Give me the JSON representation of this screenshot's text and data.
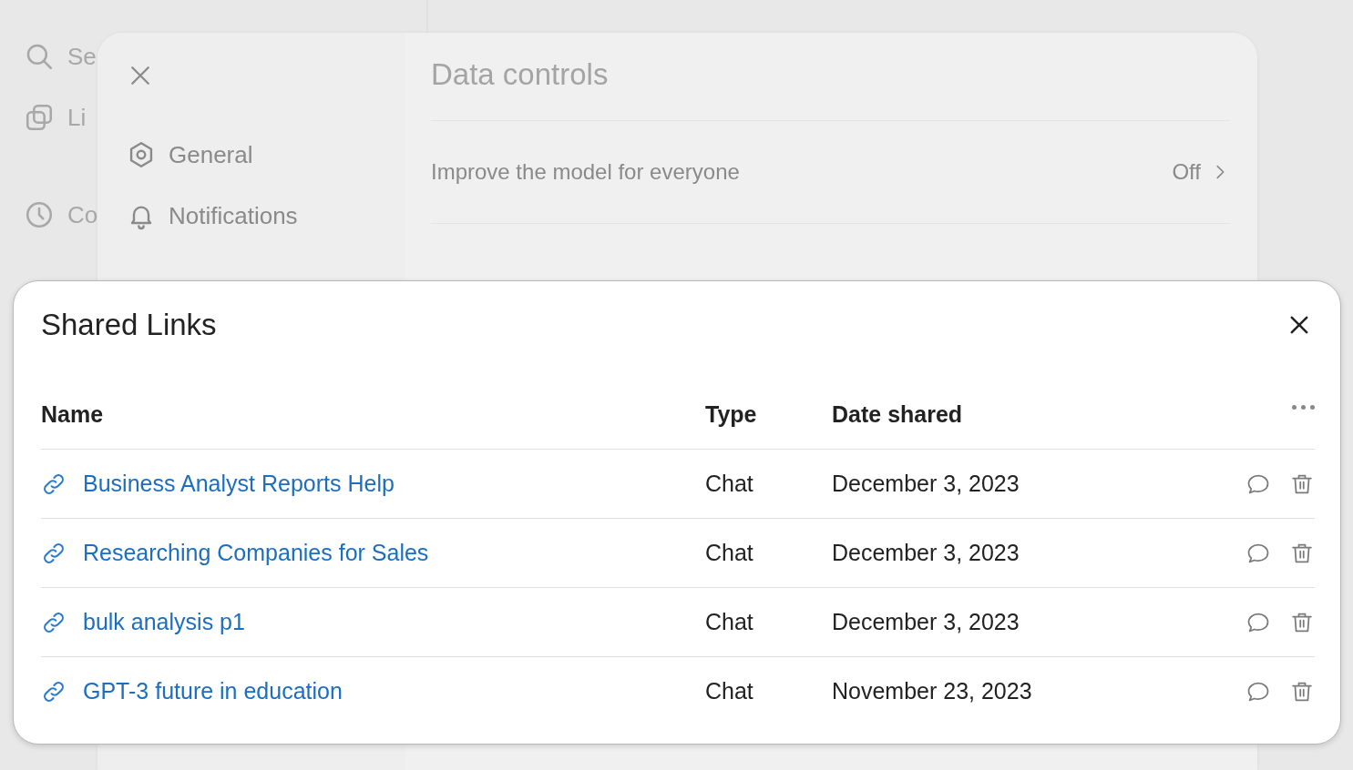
{
  "sidebar": {
    "items": [
      {
        "label": "Se"
      },
      {
        "label": "Li"
      },
      {
        "label": "Co"
      }
    ]
  },
  "settings": {
    "nav": [
      {
        "label": "General",
        "selected": false
      },
      {
        "label": "Notifications",
        "selected": false
      }
    ],
    "title": "Data controls",
    "rows": [
      {
        "kind": "value",
        "label": "Improve the model for everyone",
        "value": "Off"
      }
    ]
  },
  "shared_links": {
    "title": "Shared Links",
    "columns": [
      "Name",
      "Type",
      "Date shared"
    ],
    "rows": [
      {
        "name": "Business Analyst Reports Help",
        "type": "Chat",
        "date": "December 3, 2023"
      },
      {
        "name": "Researching Companies for Sales",
        "type": "Chat",
        "date": "December 3, 2023"
      },
      {
        "name": "bulk analysis p1",
        "type": "Chat",
        "date": "December 3, 2023"
      },
      {
        "name": "GPT-3 future in education",
        "type": "Chat",
        "date": "November 23, 2023"
      }
    ]
  }
}
